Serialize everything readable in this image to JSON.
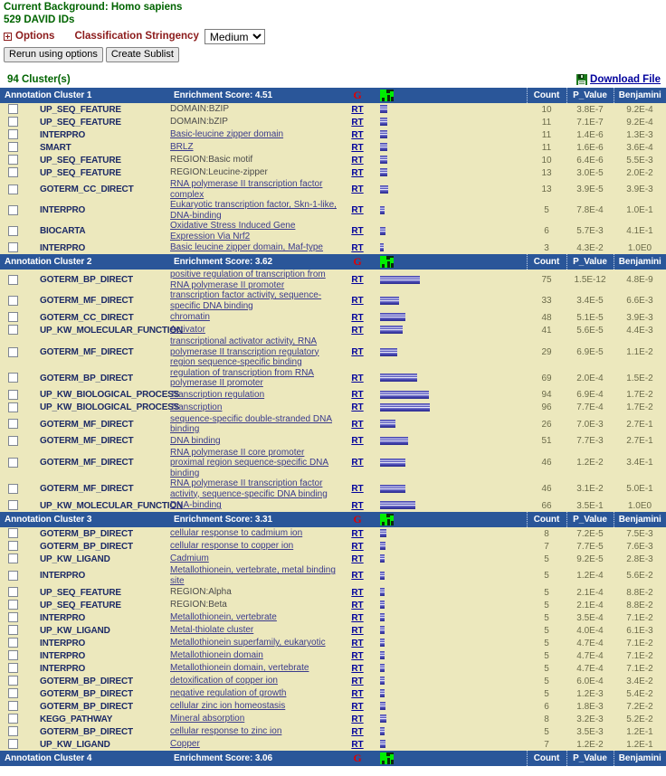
{
  "header": {
    "background_line": "Current Background: Homo sapiens",
    "ids_line": "529 DAVID IDs",
    "options_label": "Options",
    "stringency_label": "Classification Stringency",
    "stringency_value": "Medium",
    "stringency_options": [
      "Medium"
    ],
    "rerun_button": "Rerun using options",
    "sublist_button": "Create Sublist",
    "cluster_count": "94 Cluster(s)",
    "download_label": "Download File",
    "accent_green": "#006400",
    "accent_dark_red": "#8b1a1a",
    "header_blue": "#2a5699",
    "row_bg": "#ece8bd"
  },
  "columns": {
    "count": "Count",
    "p_value": "P_Value",
    "benjamini": "Benjamini",
    "g_icon": "G"
  },
  "clusters": [
    {
      "name": "Annotation Cluster 1",
      "score": "Enrichment Score: 4.51",
      "rows": [
        {
          "category": "UP_SEQ_FEATURE",
          "term": "DOMAIN:BZIP",
          "link": false,
          "count": "10",
          "p": "3.8E-7",
          "b": "9.2E-4",
          "bar": 8
        },
        {
          "category": "UP_SEQ_FEATURE",
          "term": "DOMAIN:bZIP",
          "link": false,
          "count": "11",
          "p": "7.1E-7",
          "b": "9.2E-4",
          "bar": 8
        },
        {
          "category": "INTERPRO",
          "term": "Basic-leucine zipper domain",
          "link": true,
          "count": "11",
          "p": "1.4E-6",
          "b": "1.3E-3",
          "bar": 8
        },
        {
          "category": "SMART",
          "term": "BRLZ",
          "link": true,
          "count": "11",
          "p": "1.6E-6",
          "b": "3.6E-4",
          "bar": 8
        },
        {
          "category": "UP_SEQ_FEATURE",
          "term": "REGION:Basic motif",
          "link": false,
          "count": "10",
          "p": "6.4E-6",
          "b": "5.5E-3",
          "bar": 8
        },
        {
          "category": "UP_SEQ_FEATURE",
          "term": "REGION:Leucine-zipper",
          "link": false,
          "count": "13",
          "p": "3.0E-5",
          "b": "2.0E-2",
          "bar": 8
        },
        {
          "category": "GOTERM_CC_DIRECT",
          "term": "RNA polymerase II transcription factor complex",
          "link": true,
          "count": "13",
          "p": "3.9E-5",
          "b": "3.9E-3",
          "bar": 9
        },
        {
          "category": "INTERPRO",
          "term": "Eukaryotic transcription factor, Skn-1-like, DNA-binding",
          "link": true,
          "count": "5",
          "p": "7.8E-4",
          "b": "1.0E-1",
          "bar": 5
        },
        {
          "category": "BIOCARTA",
          "term": "Oxidative Stress Induced Gene Expression Via Nrf2",
          "link": true,
          "count": "6",
          "p": "5.7E-3",
          "b": "4.1E-1",
          "bar": 6
        },
        {
          "category": "INTERPRO",
          "term": "Basic leucine zipper domain, Maf-type",
          "link": true,
          "count": "3",
          "p": "4.3E-2",
          "b": "1.0E0",
          "bar": 4
        }
      ]
    },
    {
      "name": "Annotation Cluster 2",
      "score": "Enrichment Score: 3.62",
      "rows": [
        {
          "category": "GOTERM_BP_DIRECT",
          "term": "positive regulation of transcription from RNA polymerase II promoter",
          "link": true,
          "count": "75",
          "p": "1.5E-12",
          "b": "4.8E-9",
          "bar": 44
        },
        {
          "category": "GOTERM_MF_DIRECT",
          "term": "transcription factor activity, sequence-specific DNA binding",
          "link": true,
          "count": "33",
          "p": "3.4E-5",
          "b": "6.6E-3",
          "bar": 21
        },
        {
          "category": "GOTERM_CC_DIRECT",
          "term": "chromatin",
          "link": true,
          "count": "48",
          "p": "5.1E-5",
          "b": "3.9E-3",
          "bar": 28
        },
        {
          "category": "UP_KW_MOLECULAR_FUNCTION",
          "term": "Activator",
          "link": true,
          "count": "41",
          "p": "5.6E-5",
          "b": "4.4E-3",
          "bar": 25
        },
        {
          "category": "GOTERM_MF_DIRECT",
          "term": "transcriptional activator activity, RNA polymerase II transcription regulatory region sequence-specific binding",
          "link": true,
          "count": "29",
          "p": "6.9E-5",
          "b": "1.1E-2",
          "bar": 19
        },
        {
          "category": "GOTERM_BP_DIRECT",
          "term": "regulation of transcription from RNA polymerase II promoter",
          "link": true,
          "count": "69",
          "p": "2.0E-4",
          "b": "1.5E-2",
          "bar": 41
        },
        {
          "category": "UP_KW_BIOLOGICAL_PROCESS",
          "term": "Transcription regulation",
          "link": true,
          "count": "94",
          "p": "6.9E-4",
          "b": "1.7E-2",
          "bar": 54
        },
        {
          "category": "UP_KW_BIOLOGICAL_PROCESS",
          "term": "Transcription",
          "link": true,
          "count": "96",
          "p": "7.7E-4",
          "b": "1.7E-2",
          "bar": 55
        },
        {
          "category": "GOTERM_MF_DIRECT",
          "term": "sequence-specific double-stranded DNA binding",
          "link": true,
          "count": "26",
          "p": "7.0E-3",
          "b": "2.7E-1",
          "bar": 17
        },
        {
          "category": "GOTERM_MF_DIRECT",
          "term": "DNA binding",
          "link": true,
          "count": "51",
          "p": "7.7E-3",
          "b": "2.7E-1",
          "bar": 31
        },
        {
          "category": "GOTERM_MF_DIRECT",
          "term": "RNA polymerase II core promoter proximal region sequence-specific DNA binding",
          "link": true,
          "count": "46",
          "p": "1.2E-2",
          "b": "3.4E-1",
          "bar": 28
        },
        {
          "category": "GOTERM_MF_DIRECT",
          "term": "RNA polymerase II transcription factor activity, sequence-specific DNA binding",
          "link": true,
          "count": "46",
          "p": "3.1E-2",
          "b": "5.0E-1",
          "bar": 28
        },
        {
          "category": "UP_KW_MOLECULAR_FUNCTION",
          "term": "DNA-binding",
          "link": true,
          "count": "66",
          "p": "3.5E-1",
          "b": "1.0E0",
          "bar": 39
        }
      ]
    },
    {
      "name": "Annotation Cluster 3",
      "score": "Enrichment Score: 3.31",
      "rows": [
        {
          "category": "GOTERM_BP_DIRECT",
          "term": "cellular response to cadmium ion",
          "link": true,
          "count": "8",
          "p": "7.2E-5",
          "b": "7.5E-3",
          "bar": 7
        },
        {
          "category": "GOTERM_BP_DIRECT",
          "term": "cellular response to copper ion",
          "link": true,
          "count": "7",
          "p": "7.7E-5",
          "b": "7.6E-3",
          "bar": 6
        },
        {
          "category": "UP_KW_LIGAND",
          "term": "Cadmium",
          "link": true,
          "count": "5",
          "p": "9.2E-5",
          "b": "2.8E-3",
          "bar": 5
        },
        {
          "category": "INTERPRO",
          "term": "Metallothionein, vertebrate, metal binding site",
          "link": true,
          "count": "5",
          "p": "1.2E-4",
          "b": "5.6E-2",
          "bar": 5
        },
        {
          "category": "UP_SEQ_FEATURE",
          "term": "REGION:Alpha",
          "link": false,
          "count": "5",
          "p": "2.1E-4",
          "b": "8.8E-2",
          "bar": 5
        },
        {
          "category": "UP_SEQ_FEATURE",
          "term": "REGION:Beta",
          "link": false,
          "count": "5",
          "p": "2.1E-4",
          "b": "8.8E-2",
          "bar": 5
        },
        {
          "category": "INTERPRO",
          "term": "Metallothionein, vertebrate",
          "link": true,
          "count": "5",
          "p": "3.5E-4",
          "b": "7.1E-2",
          "bar": 5
        },
        {
          "category": "UP_KW_LIGAND",
          "term": "Metal-thiolate cluster",
          "link": true,
          "count": "5",
          "p": "4.0E-4",
          "b": "6.1E-3",
          "bar": 5
        },
        {
          "category": "INTERPRO",
          "term": "Metallothionein superfamily, eukaryotic",
          "link": true,
          "count": "5",
          "p": "4.7E-4",
          "b": "7.1E-2",
          "bar": 5
        },
        {
          "category": "INTERPRO",
          "term": "Metallothionein domain",
          "link": true,
          "count": "5",
          "p": "4.7E-4",
          "b": "7.1E-2",
          "bar": 5
        },
        {
          "category": "INTERPRO",
          "term": "Metallothionein domain, vertebrate",
          "link": true,
          "count": "5",
          "p": "4.7E-4",
          "b": "7.1E-2",
          "bar": 5
        },
        {
          "category": "GOTERM_BP_DIRECT",
          "term": "detoxification of copper ion",
          "link": true,
          "count": "5",
          "p": "6.0E-4",
          "b": "3.4E-2",
          "bar": 5
        },
        {
          "category": "GOTERM_BP_DIRECT",
          "term": "negative regulation of growth",
          "link": true,
          "count": "5",
          "p": "1.2E-3",
          "b": "5.4E-2",
          "bar": 5
        },
        {
          "category": "GOTERM_BP_DIRECT",
          "term": "cellular zinc ion homeostasis",
          "link": true,
          "count": "6",
          "p": "1.8E-3",
          "b": "7.2E-2",
          "bar": 6
        },
        {
          "category": "KEGG_PATHWAY",
          "term": "Mineral absorption",
          "link": true,
          "count": "8",
          "p": "3.2E-3",
          "b": "5.2E-2",
          "bar": 7
        },
        {
          "category": "GOTERM_BP_DIRECT",
          "term": "cellular response to zinc ion",
          "link": true,
          "count": "5",
          "p": "3.5E-3",
          "b": "1.2E-1",
          "bar": 5
        },
        {
          "category": "UP_KW_LIGAND",
          "term": "Copper",
          "link": true,
          "count": "7",
          "p": "1.2E-2",
          "b": "1.2E-1",
          "bar": 6
        }
      ]
    },
    {
      "name": "Annotation Cluster 4",
      "score": "Enrichment Score: 3.06",
      "rows": []
    }
  ]
}
